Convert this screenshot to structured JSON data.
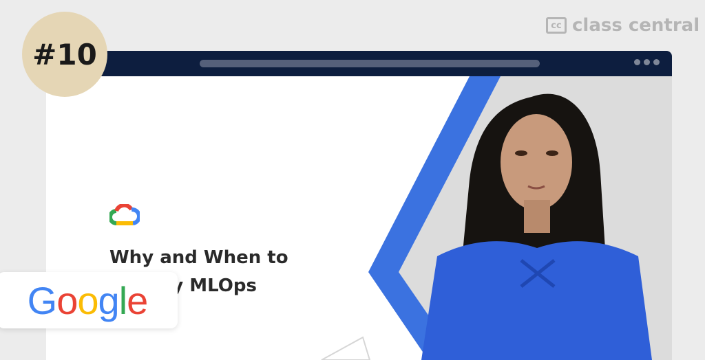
{
  "brand": {
    "mark": "cc",
    "name": "class central"
  },
  "rank": "#10",
  "browser": {
    "dots": 3
  },
  "slide": {
    "title_line1": "Why and When to",
    "title_line2": "Employ MLOps"
  },
  "sponsor": {
    "letters": [
      {
        "char": "G",
        "color": "blue"
      },
      {
        "char": "o",
        "color": "red"
      },
      {
        "char": "o",
        "color": "yellow"
      },
      {
        "char": "g",
        "color": "blue"
      },
      {
        "char": "l",
        "color": "green"
      },
      {
        "char": "e",
        "color": "red"
      }
    ]
  },
  "colors": {
    "accent_blue": "#3b72e0",
    "titlebar": "#0d1e3f",
    "badge": "#e5d6b5",
    "presenter_top": "#2f5fd8"
  },
  "icons": [
    "google-cloud-icon",
    "class-central-logo-icon",
    "window-dots-icon"
  ]
}
